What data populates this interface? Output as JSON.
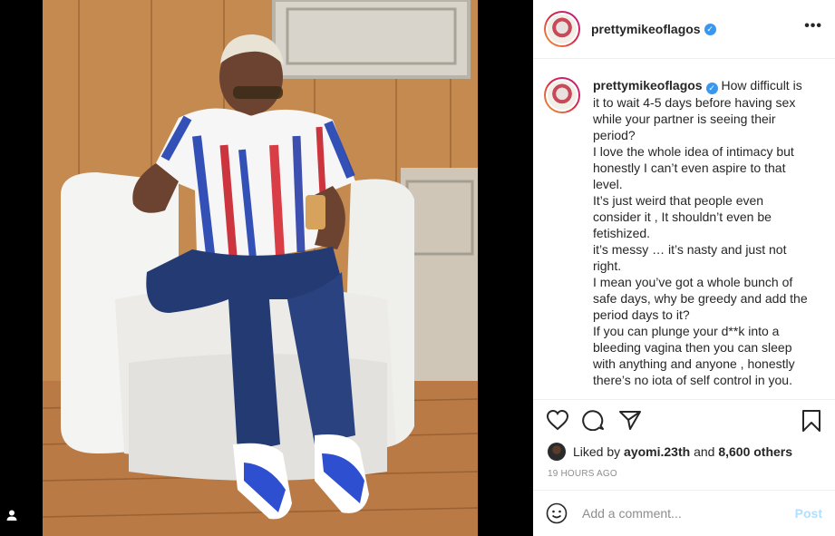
{
  "post": {
    "username": "prettymikeoflagos",
    "verified_mark": "✓",
    "more_icon": "more-horizontal-icon",
    "caption_lines": [
      "How difficult is",
      "it to wait 4-5 days before having sex",
      "while your partner is seeing their",
      "period?",
      "I love the whole idea of intimacy but",
      "honestly I can’t even aspire to that",
      "level.",
      "It’s just weird that people even",
      "consider it , It shouldn’t even be",
      "fetishized.",
      "it’s messy … it’s nasty and just not",
      "right.",
      "I mean you’ve got a whole bunch of",
      "safe days, why be greedy and add the",
      "period days to it?",
      "If you can plunge your d**k into a",
      "bleeding vagina then you can sleep",
      "with anything and anyone , honestly",
      "there’s no iota of self control in you."
    ],
    "liked_by_prefix": "Liked by",
    "liked_by_user": "ayomi.23th",
    "liked_by_and": "and",
    "liked_by_count": "8,600 others",
    "time_ago": "19 HOURS AGO"
  },
  "comment": {
    "placeholder": "Add a comment...",
    "post_label": "Post"
  },
  "colors": {
    "verified": "#3897f0",
    "post_button": "#b2dffc",
    "muted": "#8e8e8e"
  }
}
